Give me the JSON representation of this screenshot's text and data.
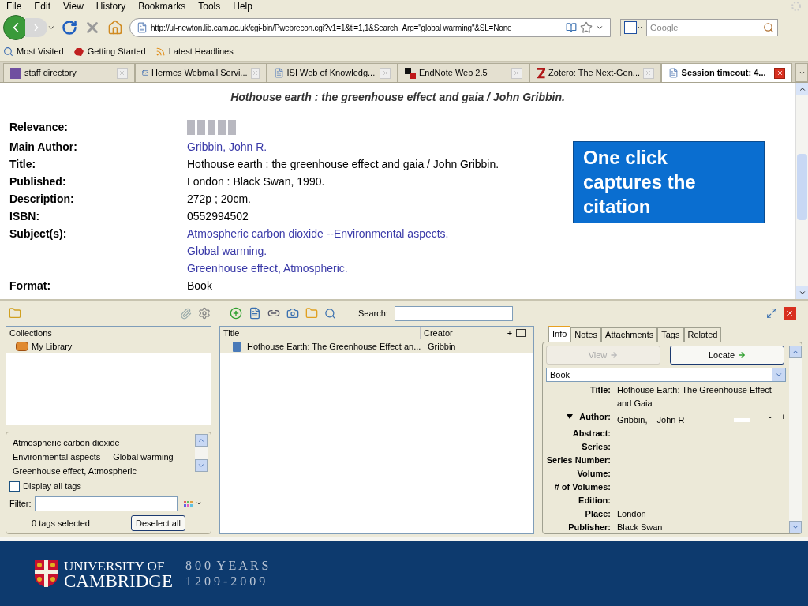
{
  "menu": [
    "File",
    "Edit",
    "View",
    "History",
    "Bookmarks",
    "Tools",
    "Help"
  ],
  "navbar": {
    "url": "http://ul-newton.lib.cam.ac.uk/cgi-bin/Pwebrecon.cgi?v1=1&ti=1,1&Search_Arg=\"global warming\"&SL=None",
    "search_placeholder": "Google"
  },
  "bookmarks": [
    "Most Visited",
    "Getting Started",
    "Latest Headlines"
  ],
  "tabs": [
    {
      "label": "staff directory",
      "selected": false
    },
    {
      "label": "Hermes Webmail Servi...",
      "selected": false
    },
    {
      "label": "ISI Web of Knowledg...",
      "selected": false
    },
    {
      "label": "EndNote Web 2.5",
      "selected": false
    },
    {
      "label": "Zotero: The Next-Gen...",
      "selected": false
    },
    {
      "label": "Session timeout: 4...",
      "selected": true
    }
  ],
  "record": {
    "heading": "Hothouse earth : the greenhouse effect and gaia / John Gribbin.",
    "fields": [
      {
        "label": "Relevance:",
        "kind": "relevance"
      },
      {
        "label": "Main Author:",
        "kind": "link",
        "values": [
          "Gribbin, John R."
        ]
      },
      {
        "label": "Title:",
        "kind": "text",
        "values": [
          "Hothouse earth : the greenhouse effect and gaia / John Gribbin."
        ]
      },
      {
        "label": "Published:",
        "kind": "text",
        "values": [
          "London : Black Swan, 1990."
        ]
      },
      {
        "label": "Description:",
        "kind": "text",
        "values": [
          "272p ; 20cm."
        ]
      },
      {
        "label": "ISBN:",
        "kind": "text",
        "values": [
          "0552994502"
        ]
      },
      {
        "label": "Subject(s):",
        "kind": "link",
        "values": [
          "Atmospheric carbon dioxide --Environmental aspects.",
          "Global warming.",
          "Greenhouse effect, Atmospheric."
        ]
      },
      {
        "label": "Format:",
        "kind": "text",
        "values": [
          "Book"
        ]
      }
    ]
  },
  "callout": "One click captures the citation",
  "zotero": {
    "search_label": "Search:",
    "collections": {
      "header": "Collections",
      "items": [
        {
          "label": "My Library",
          "selected": true
        }
      ]
    },
    "tags": [
      "Atmospheric carbon dioxide",
      "Environmental aspects",
      "Global warming",
      "Greenhouse effect, Atmospheric"
    ],
    "display_all_tags": {
      "label": "Display all tags",
      "checked": false
    },
    "filter_label": "Filter:",
    "tags_selected": "0 tags selected",
    "deselect_button": "Deselect all",
    "items": {
      "columns": [
        "Title",
        "Creator"
      ],
      "add_column": "+",
      "rows": [
        {
          "title": "Hothouse Earth: The Greenhouse Effect an...",
          "creator": "Gribbin",
          "selected": true
        }
      ]
    },
    "detail": {
      "tabs": [
        {
          "label": "Info",
          "selected": true
        },
        {
          "label": "Notes",
          "selected": false
        },
        {
          "label": "Attachments",
          "selected": false
        },
        {
          "label": "Tags",
          "selected": false
        },
        {
          "label": "Related",
          "selected": false
        }
      ],
      "buttons": [
        {
          "label": "View",
          "disabled": true
        },
        {
          "label": "Locate",
          "disabled": false
        }
      ],
      "item_type": "Book",
      "fields": [
        {
          "label": "Title:",
          "kind": "text",
          "value": "Hothouse Earth: The Greenhouse Effect and Gaia"
        },
        {
          "label": "Author:",
          "kind": "creator",
          "value": "Gribbin,",
          "value2": "John R",
          "remove": "-",
          "add": "+"
        },
        {
          "label": "Abstract:",
          "kind": "text"
        },
        {
          "label": "Series:",
          "kind": "text"
        },
        {
          "label": "Series Number:",
          "kind": "text"
        },
        {
          "label": "Volume:",
          "kind": "text"
        },
        {
          "label": "# of Volumes:",
          "kind": "text"
        },
        {
          "label": "Edition:",
          "kind": "text"
        },
        {
          "label": "Place:",
          "kind": "text",
          "value": "London"
        },
        {
          "label": "Publisher:",
          "kind": "text",
          "value": "Black Swan"
        }
      ]
    }
  },
  "footer": {
    "university": [
      "UNIVERSITY OF",
      "CAMBRIDGE"
    ],
    "anniversary": [
      "8 0 0  Y E A R S",
      "1 2 0 9 - 2 0 0 9"
    ]
  }
}
